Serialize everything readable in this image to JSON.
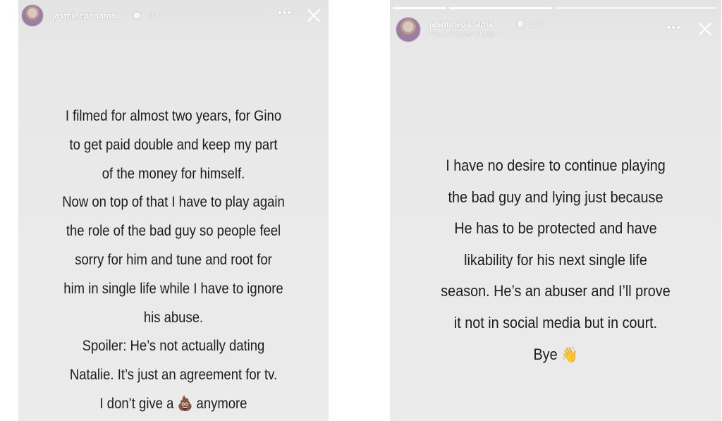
{
  "stories": [
    {
      "username": "jasminepanama",
      "time": "10h",
      "more_icon": "more-horizontal-icon",
      "close_icon": "close-icon",
      "lines": [
        "I filmed for almost two years, for Gino",
        "to get paid double and keep my part",
        "of the money for himself.",
        "Now on top of that I have to play again",
        "the role of the bad guy so people feel",
        "sorry for him and tune and root for",
        "him in single life while I have to ignore",
        "his abuse.",
        "Spoiler: He’s not actually dating",
        "Natalie. It’s just an agreement for tv.",
        "I don’t give a",
        "anymore"
      ],
      "emoji_poop": "💩"
    },
    {
      "username": "jasminepanama",
      "time": "11h",
      "subtitle": "From Create Mode >",
      "more_icon": "more-horizontal-icon",
      "close_icon": "close-icon",
      "lines": [
        "I have no desire to continue playing",
        "the bad guy and lying  just because",
        "He has to be protected and have",
        "likability for his next single life",
        "season. He’s an abuser and I’ll prove",
        "it not in social media but in court.",
        "Bye"
      ],
      "emoji_wave": "👋"
    }
  ]
}
